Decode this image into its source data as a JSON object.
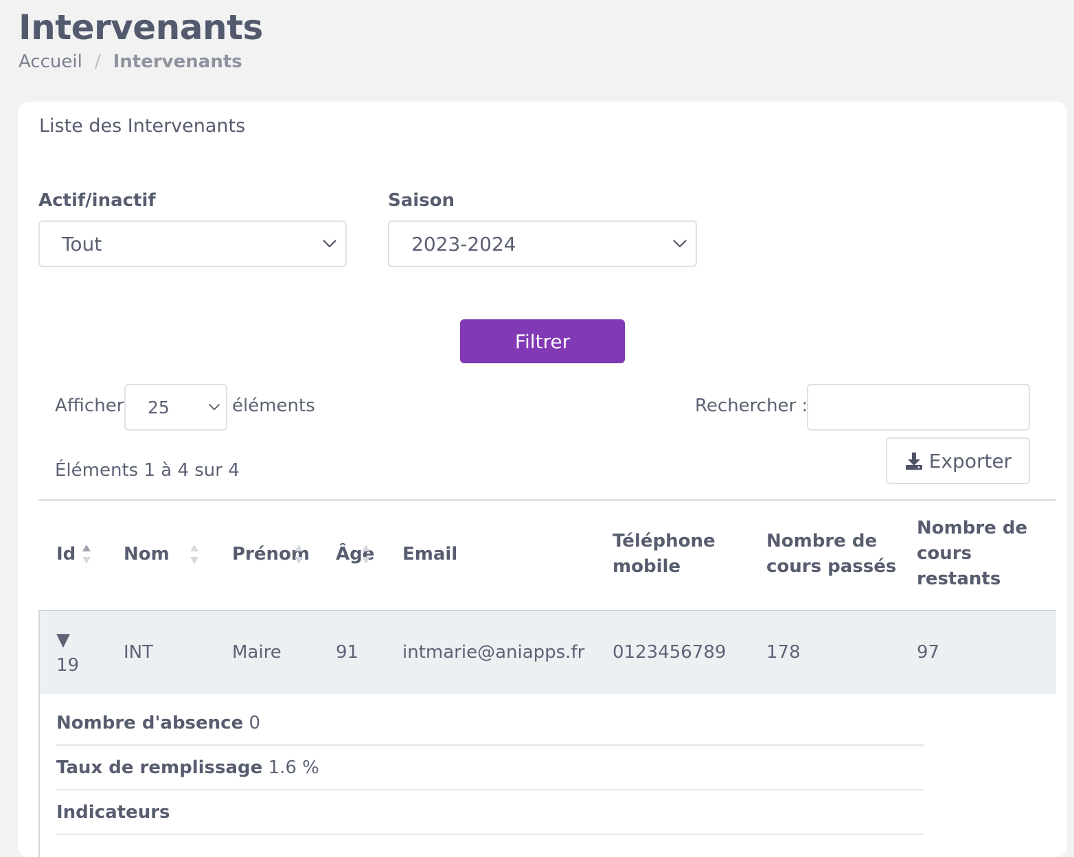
{
  "page": {
    "title": "Intervenants",
    "breadcrumb": {
      "home": "Accueil",
      "separator": "/",
      "current": "Intervenants"
    }
  },
  "card": {
    "title": "Liste des Intervenants",
    "filters": {
      "status": {
        "label": "Actif/inactif",
        "value": "Tout"
      },
      "season": {
        "label": "Saison",
        "value": "2023-2024"
      },
      "submit_label": "Filtrer"
    },
    "table_controls": {
      "show_prefix": "Afficher",
      "page_size": "25",
      "show_suffix": "éléments",
      "search_label": "Rechercher :",
      "search_value": "",
      "info": "Éléments 1 à 4 sur 4",
      "export_label": "Exporter"
    },
    "table": {
      "headers": {
        "id": "Id",
        "nom": "Nom",
        "prenom": "Prénom",
        "age": "Âge",
        "email": "Email",
        "phone_line1": "Téléphone",
        "phone_line2": "mobile",
        "past_line1": "Nombre de",
        "past_line2": "cours passés",
        "remaining_line1": "Nombre de",
        "remaining_line2": "cours",
        "remaining_line3": "restants"
      },
      "rows": [
        {
          "expand_glyph": "▼",
          "id": "19",
          "nom": "INT",
          "prenom": "Maire",
          "age": "91",
          "email": "intmarie@aniapps.fr",
          "phone": "0123456789",
          "past": "178",
          "remaining": "97",
          "details": {
            "absence_label": "Nombre d'absence",
            "absence_value": "0",
            "fill_label": "Taux de remplissage",
            "fill_value": "1.6 %",
            "indicators_label": "Indicateurs"
          }
        }
      ]
    }
  },
  "colors": {
    "background": "#f2f2f3",
    "accent": "#8139b6",
    "text": "#575d6f",
    "row_highlight": "#edf0f3"
  },
  "icons": [
    "chevron-down-icon",
    "download-icon",
    "sort-icon",
    "expand-caret-icon"
  ]
}
